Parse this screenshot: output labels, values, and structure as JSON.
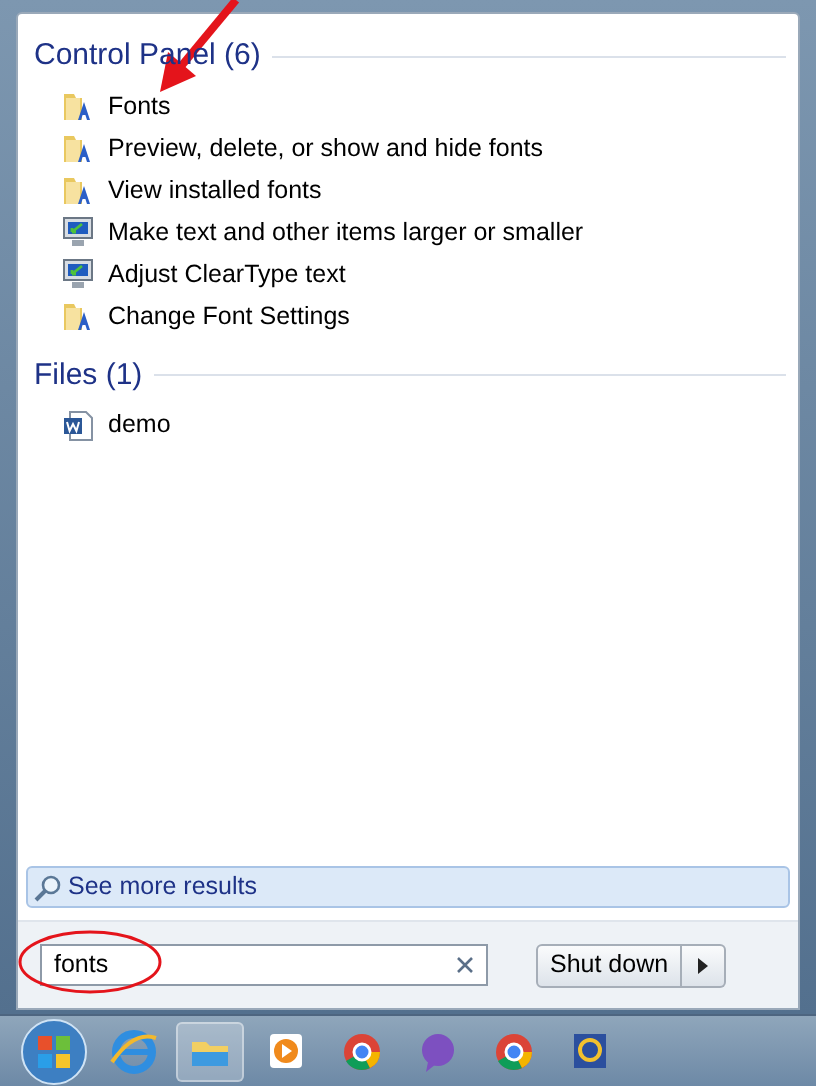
{
  "groups": [
    {
      "title": "Control Panel (6)",
      "items": [
        {
          "kind": "folder",
          "label": "Fonts"
        },
        {
          "kind": "folder",
          "label": "Preview, delete, or show and hide fonts"
        },
        {
          "kind": "folder",
          "label": "View installed fonts"
        },
        {
          "kind": "display",
          "label": "Make text and other items larger or smaller"
        },
        {
          "kind": "display",
          "label": "Adjust ClearType text"
        },
        {
          "kind": "folder",
          "label": "Change Font Settings"
        }
      ]
    },
    {
      "title": "Files (1)",
      "items": [
        {
          "kind": "document",
          "label": "demo"
        }
      ]
    }
  ],
  "more_results": "See more results",
  "search": {
    "value": "fonts"
  },
  "shutdown": {
    "label": "Shut down"
  }
}
